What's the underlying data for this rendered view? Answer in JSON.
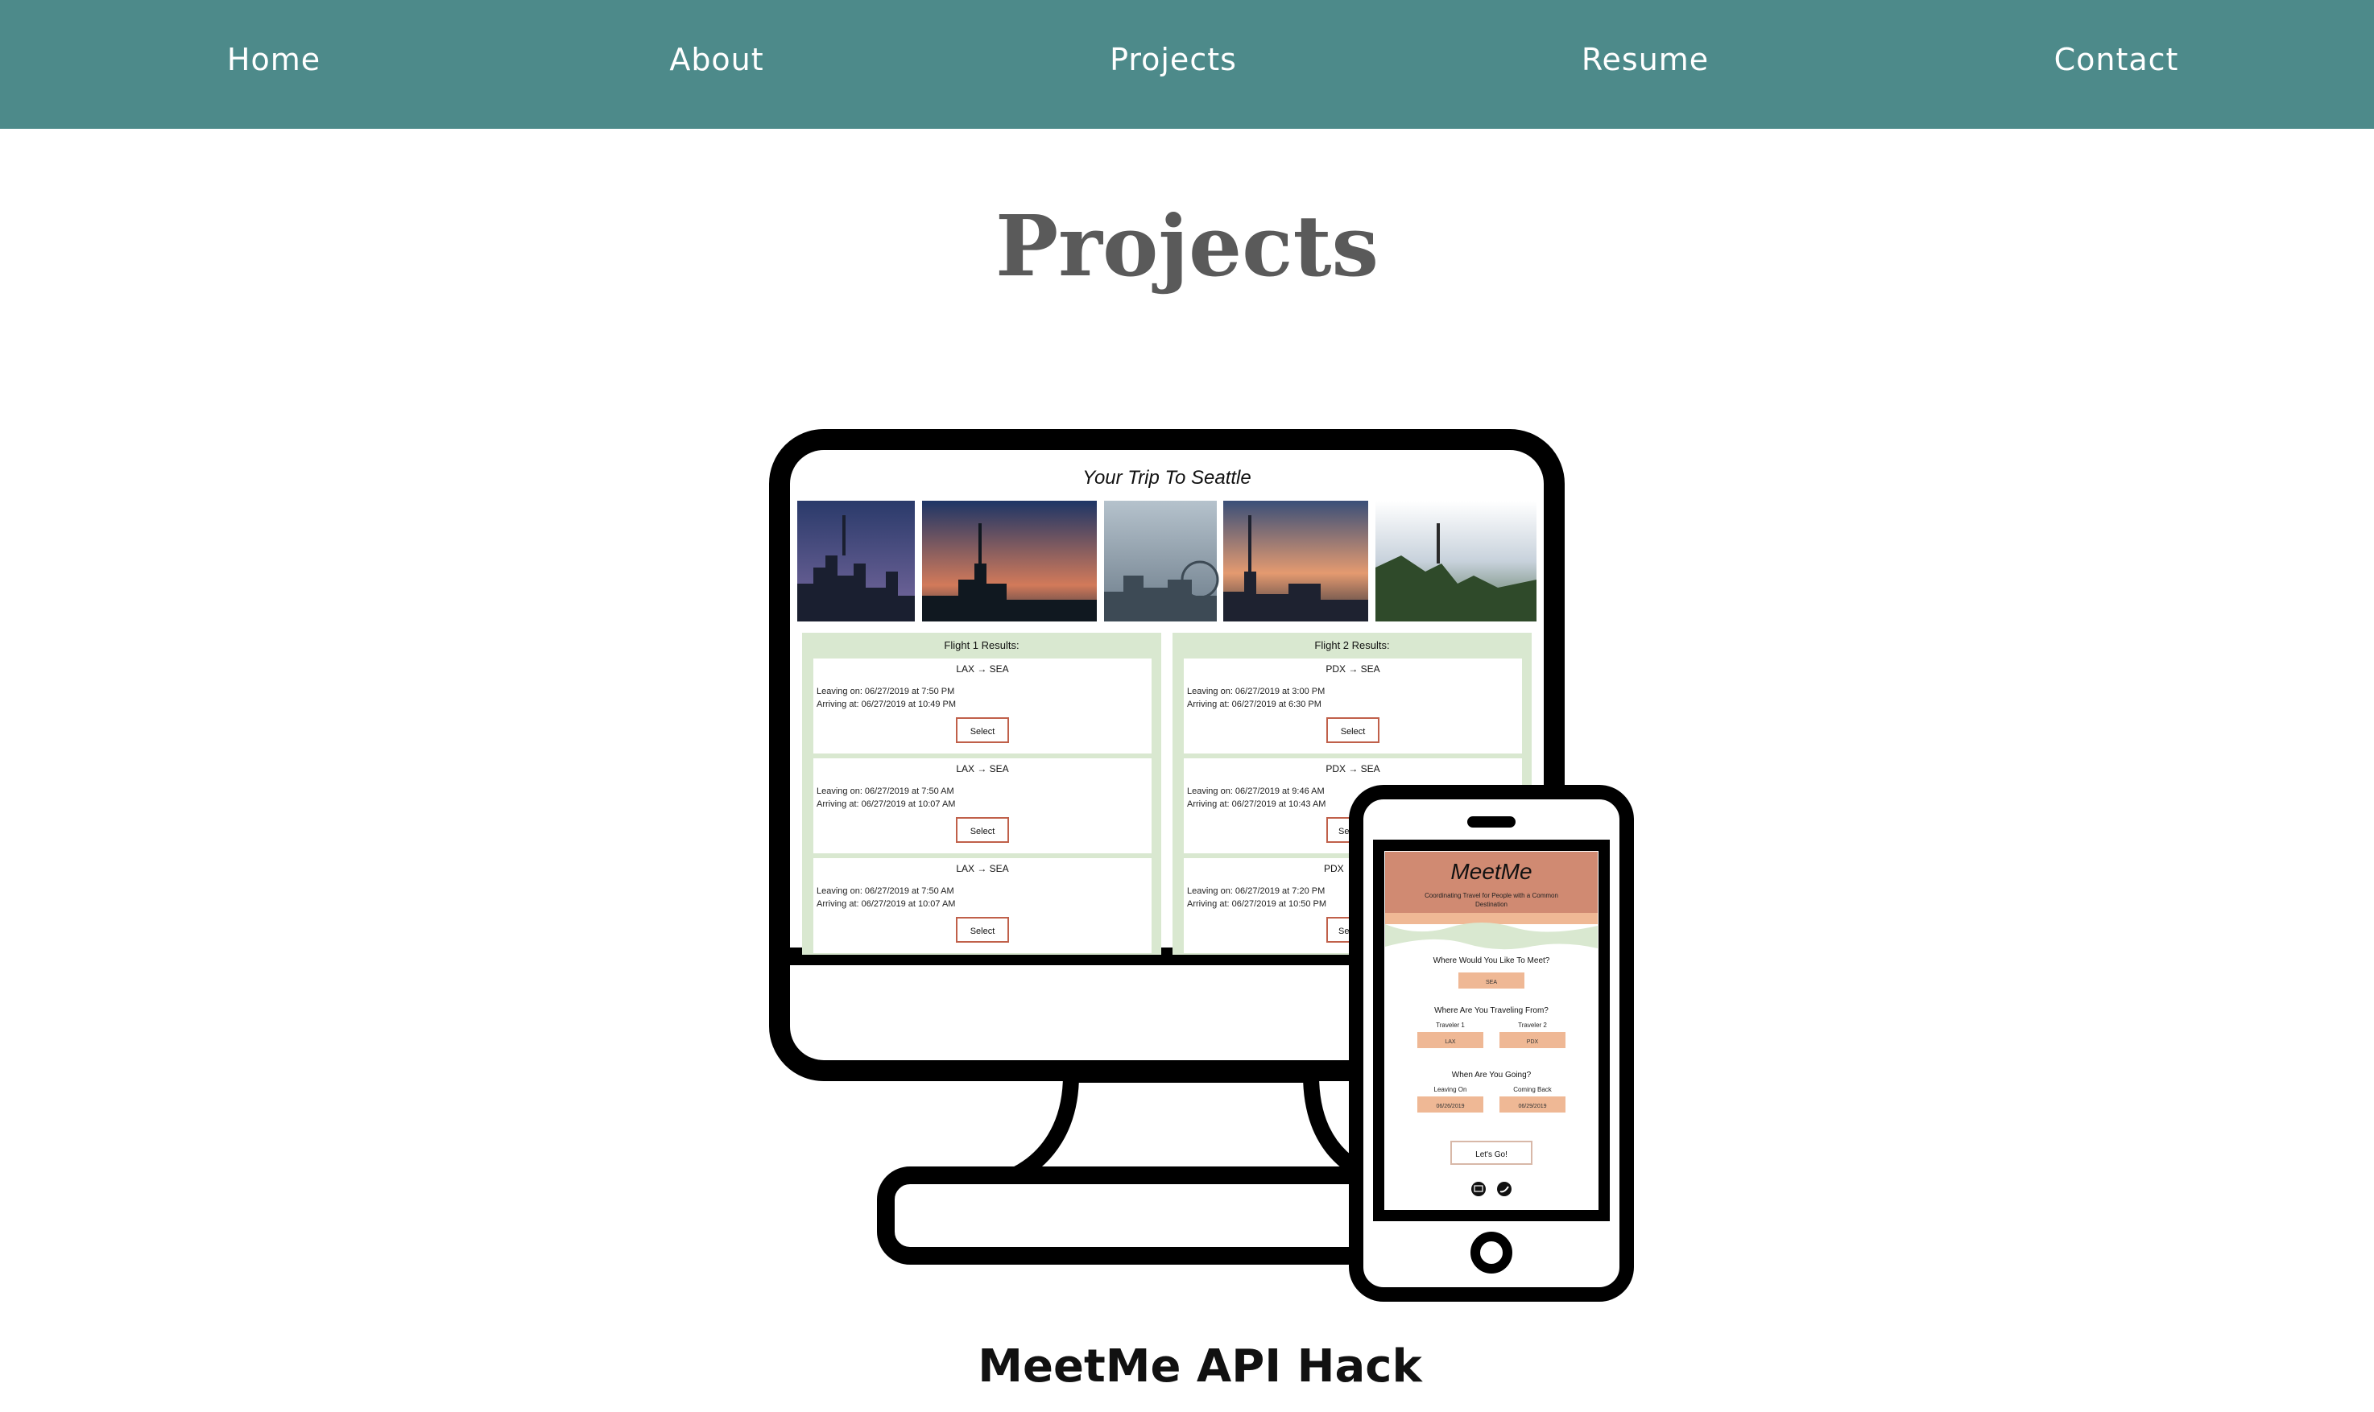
{
  "nav": {
    "items": [
      {
        "label": "Home"
      },
      {
        "label": "About"
      },
      {
        "label": "Projects"
      },
      {
        "label": "Resume"
      },
      {
        "label": "Contact"
      }
    ]
  },
  "page": {
    "title": "Projects"
  },
  "project": {
    "title": "MeetMe API Hack",
    "desktop": {
      "heading": "Your Trip To Seattle",
      "flight1": {
        "header": "Flight 1 Results:",
        "cards": [
          {
            "route": "LAX → SEA",
            "leaving": "Leaving on: 06/27/2019 at 7:50 PM",
            "arriving": "Arriving at: 06/27/2019 at 10:49 PM",
            "button": "Select"
          },
          {
            "route": "LAX → SEA",
            "leaving": "Leaving on: 06/27/2019 at 7:50 AM",
            "arriving": "Arriving at: 06/27/2019 at 10:07 AM",
            "button": "Select"
          },
          {
            "route": "LAX → SEA",
            "leaving": "Leaving on: 06/27/2019 at 7:50 AM",
            "arriving": "Arriving at: 06/27/2019 at 10:07 AM",
            "button": "Select"
          }
        ]
      },
      "flight2": {
        "header": "Flight 2 Results:",
        "cards": [
          {
            "route": "PDX → SEA",
            "leaving": "Leaving on: 06/27/2019 at 3:00 PM",
            "arriving": "Arriving at: 06/27/2019 at 6:30 PM",
            "button": "Select"
          },
          {
            "route": "PDX → SEA",
            "leaving": "Leaving on: 06/27/2019 at 9:46 AM",
            "arriving": "Arriving at: 06/27/2019 at 10:43 AM",
            "button": "Se"
          },
          {
            "route": "PDX",
            "leaving": "Leaving on: 06/27/2019 at 7:20 PM",
            "arriving": "Arriving at: 06/27/2019 at 10:50 PM",
            "button": "Se"
          }
        ]
      }
    },
    "mobile": {
      "logo": "MeetMe",
      "tagline_line1": "Coordinating Travel for People with a Common",
      "tagline_line2": "Destination",
      "meet_question": "Where Would You Like To Meet?",
      "meet_value": "SEA",
      "from_question": "Where Are You Traveling From?",
      "traveler1_label": "Traveler 1",
      "traveler1_value": "LAX",
      "traveler2_label": "Traveler 2",
      "traveler2_value": "PDX",
      "when_question": "When Are You Going?",
      "leaving_label": "Leaving On",
      "leaving_value": "06/26/2019",
      "coming_label": "Coming Back",
      "coming_value": "06/29/2019",
      "button": "Let's Go!",
      "icons": [
        "email-icon",
        "twitter-icon"
      ]
    }
  },
  "colors": {
    "nav_bg": "#4d8a8a",
    "title": "#5a5a5a",
    "flight_bg": "#d9e8d0",
    "select_border": "#c0604a",
    "mobile_header": "#d08a72",
    "mobile_field": "#efb895"
  }
}
